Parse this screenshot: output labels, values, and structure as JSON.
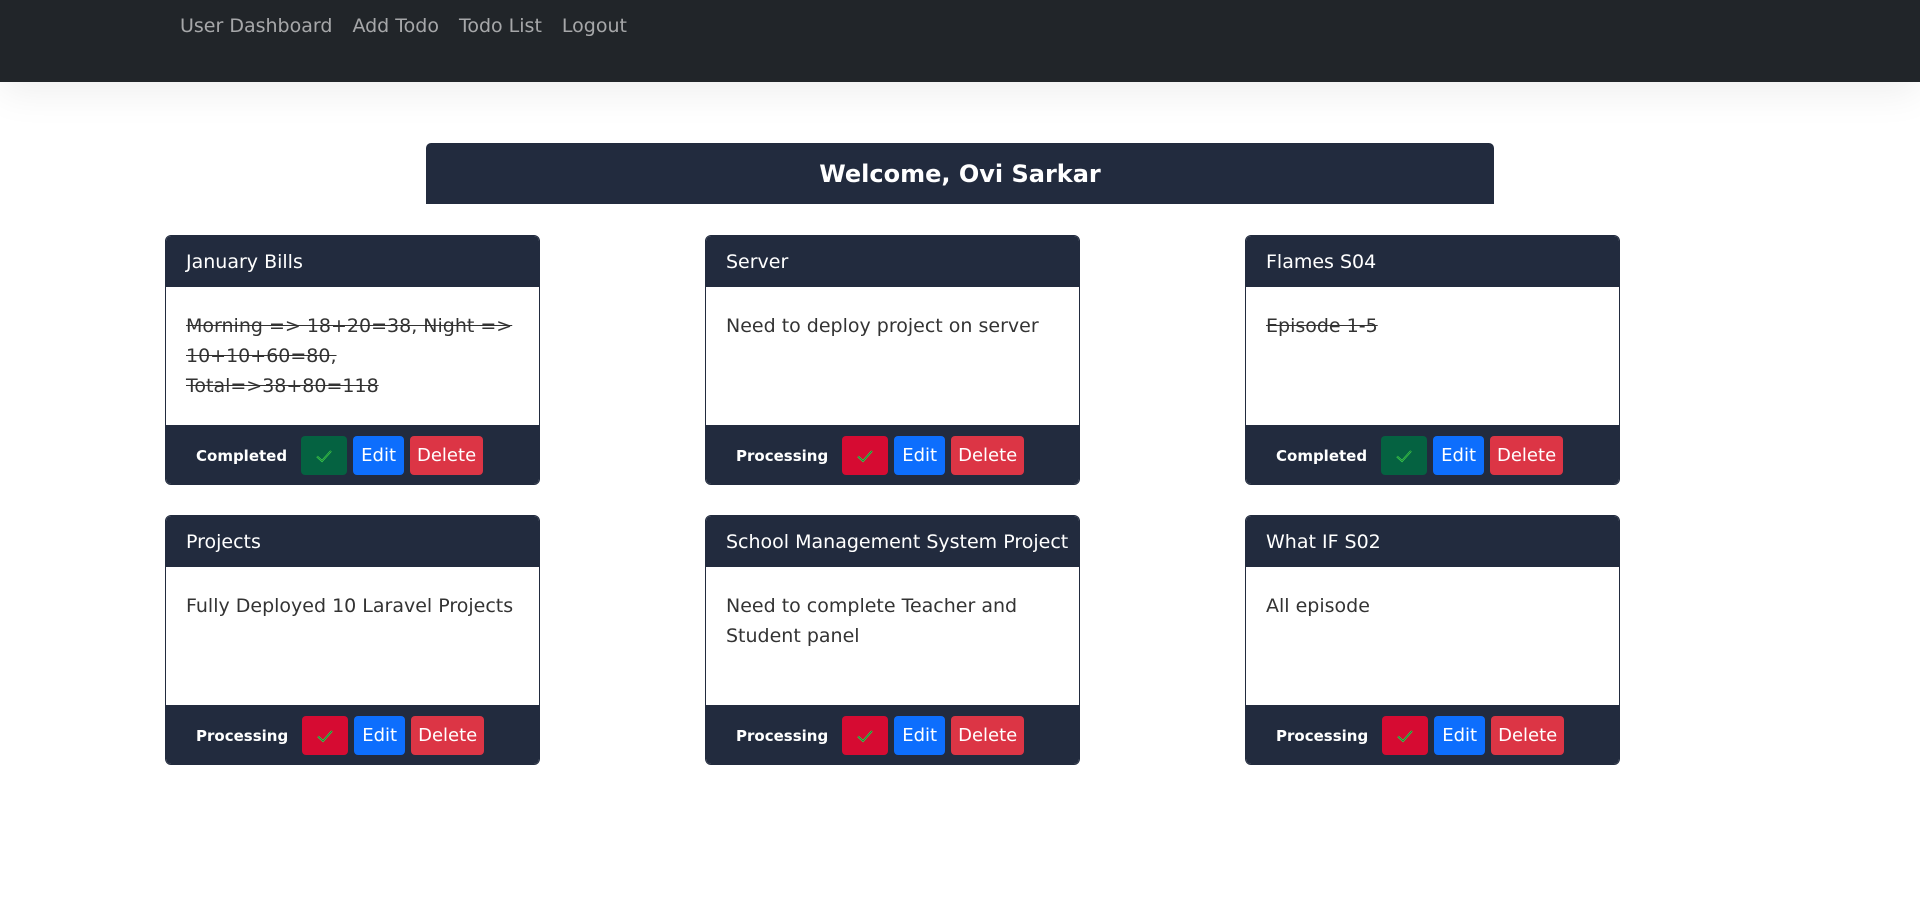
{
  "nav": {
    "items": [
      {
        "label": "User Dashboard"
      },
      {
        "label": "Add Todo"
      },
      {
        "label": "Todo List"
      },
      {
        "label": "Logout"
      }
    ]
  },
  "welcome": {
    "text": "Welcome, Ovi Sarkar"
  },
  "colors": {
    "navbar": "#212529",
    "card_header": "#222b3e",
    "completed_button": "#056241",
    "processing_button": "#d60b32",
    "edit_button": "#0d6efd",
    "delete_button": "#dc3545",
    "check_icon": "#39d353"
  },
  "todos": [
    {
      "title": "January Bills",
      "description": "Morning => 18+20=38, Night => 10+10+60=80, Total=>38+80=118",
      "status": "Completed",
      "edit_label": "Edit",
      "delete_label": "Delete",
      "check_icon": "checkmark-icon"
    },
    {
      "title": "Server",
      "description": "Need to deploy project on server",
      "status": "Processing",
      "edit_label": "Edit",
      "delete_label": "Delete",
      "check_icon": "checkmark-icon"
    },
    {
      "title": "Flames S04",
      "description": "Episode 1-5",
      "status": "Completed",
      "edit_label": "Edit",
      "delete_label": "Delete",
      "check_icon": "checkmark-icon"
    },
    {
      "title": "Projects",
      "description": "Fully Deployed 10 Laravel Projects",
      "status": "Processing",
      "edit_label": "Edit",
      "delete_label": "Delete",
      "check_icon": "checkmark-icon"
    },
    {
      "title": "School Management System Project",
      "description": "Need to complete Teacher and Student panel",
      "status": "Processing",
      "edit_label": "Edit",
      "delete_label": "Delete",
      "check_icon": "checkmark-icon"
    },
    {
      "title": "What IF S02",
      "description": "All episode",
      "status": "Processing",
      "edit_label": "Edit",
      "delete_label": "Delete",
      "check_icon": "checkmark-icon"
    }
  ]
}
